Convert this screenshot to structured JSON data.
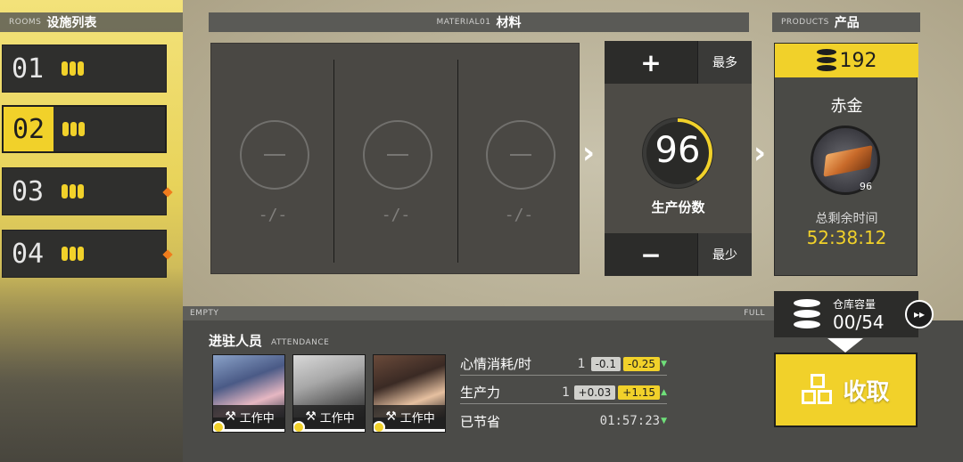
{
  "rooms": {
    "caption": "ROOMS",
    "title": "设施列表",
    "items": [
      {
        "num": "01",
        "alert": false
      },
      {
        "num": "02",
        "alert": false
      },
      {
        "num": "03",
        "alert": true
      },
      {
        "num": "04",
        "alert": true
      }
    ],
    "active_index": 1
  },
  "materials": {
    "caption": "MATERIAL01",
    "title": "材料",
    "slots": [
      {
        "count": "-/-"
      },
      {
        "count": "-/-"
      },
      {
        "count": "-/-"
      }
    ]
  },
  "production": {
    "plus_symbol": "+",
    "max_label": "最多",
    "minus_symbol": "−",
    "min_label": "最少",
    "count": "96",
    "count_fraction": 0.4,
    "count_label": "生产份数"
  },
  "products": {
    "caption": "PRODUCTS",
    "title": "产品",
    "quantity": "192",
    "name": "赤金",
    "badge": "96",
    "time_label": "总剩余时间",
    "time_value": "52:38:12"
  },
  "warehouse": {
    "label": "仓库容量",
    "value": "00/54"
  },
  "capacity_bar": {
    "empty_label": "EMPTY",
    "full_label": "FULL"
  },
  "collect": {
    "label": "收取"
  },
  "attendance": {
    "title": "进驻人员",
    "caption": "ATTENDANCE",
    "operators": [
      {
        "status": "工作中"
      },
      {
        "status": "工作中"
      },
      {
        "status": "工作中"
      }
    ]
  },
  "stats": {
    "mood": {
      "name": "心情消耗/时",
      "base": "1",
      "delta1": "-0.1",
      "delta2": "-0.25"
    },
    "productivity": {
      "name": "生产力",
      "base": "1",
      "delta1": "+0.03",
      "delta2": "+1.15"
    },
    "saved": {
      "name": "已节省",
      "value": "01:57:23"
    }
  },
  "colors": {
    "accent": "#f1d12a",
    "alert": "#f07c1c",
    "panel": "#2c2c2a"
  }
}
